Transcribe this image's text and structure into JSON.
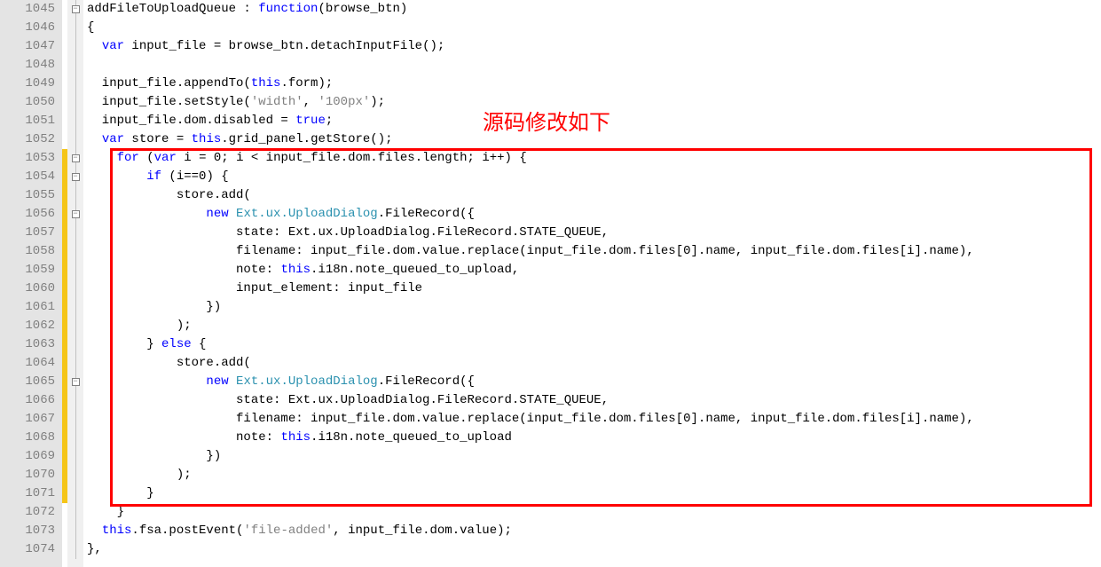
{
  "annotation": "源码修改如下",
  "lines": {
    "start": 1045,
    "end": 1074
  },
  "code": {
    "l1045": "addFileToUploadQueue : ",
    "l1045_fn": "function",
    "l1045_rest": "(browse_btn)",
    "l1046": "{",
    "l1047": "  ",
    "l1047_var": "var",
    "l1047_rest": " input_file = browse_btn.detachInputFile();",
    "l1048": "",
    "l1049": "  input_file.appendTo(",
    "l1049_this": "this",
    "l1049_rest": ".form);",
    "l1050": "  input_file.setStyle(",
    "l1050_s1": "'width'",
    "l1050_c": ", ",
    "l1050_s2": "'100px'",
    "l1050_rest": ");",
    "l1051": "  input_file.dom.disabled = ",
    "l1051_true": "true",
    "l1051_rest": ";",
    "l1052": "  ",
    "l1052_var": "var",
    "l1052_mid": " store = ",
    "l1052_this": "this",
    "l1052_rest": ".grid_panel.getStore();",
    "l1053": "    ",
    "l1053_for": "for",
    "l1053_mid": " (",
    "l1053_var": "var",
    "l1053_rest": " i = 0; i < input_file.dom.files.length; i++) {",
    "l1054": "        ",
    "l1054_if": "if",
    "l1054_rest": " (i==0) {",
    "l1055": "            store.add(",
    "l1056": "                ",
    "l1056_new": "new",
    "l1056_sp": " ",
    "l1056_type": "Ext.ux.UploadDialog",
    "l1056_rest": ".FileRecord({",
    "l1057": "                    state: Ext.ux.UploadDialog.FileRecord.STATE_QUEUE,",
    "l1058": "                    filename: input_file.dom.value.replace(input_file.dom.files[0].name, input_file.dom.files[i].name),",
    "l1059": "                    note: ",
    "l1059_this": "this",
    "l1059_rest": ".i18n.note_queued_to_upload,",
    "l1060": "                    input_element: input_file",
    "l1061": "                })",
    "l1062": "            );",
    "l1063": "        } ",
    "l1063_else": "else",
    "l1063_rest": " {",
    "l1064": "            store.add(",
    "l1065": "                ",
    "l1065_new": "new",
    "l1065_sp": " ",
    "l1065_type": "Ext.ux.UploadDialog",
    "l1065_rest": ".FileRecord({",
    "l1066": "                    state: Ext.ux.UploadDialog.FileRecord.STATE_QUEUE,",
    "l1067": "                    filename: input_file.dom.value.replace(input_file.dom.files[0].name, input_file.dom.files[i].name),",
    "l1068": "                    note: ",
    "l1068_this": "this",
    "l1068_rest": ".i18n.note_queued_to_upload",
    "l1069": "                })",
    "l1070": "            );",
    "l1071": "        }",
    "l1072": "    }",
    "l1073": "  ",
    "l1073_this": "this",
    "l1073_mid": ".fsa.postEvent(",
    "l1073_s": "'file-added'",
    "l1073_rest": ", input_file.dom.value);",
    "l1074": "},"
  },
  "fold_minus_lines": [
    1045,
    1053,
    1054,
    1056,
    1065
  ],
  "modified_lines": [
    1053,
    1054,
    1055,
    1056,
    1057,
    1058,
    1059,
    1060,
    1061,
    1062,
    1063,
    1064,
    1065,
    1066,
    1067,
    1068,
    1069,
    1070,
    1071
  ]
}
